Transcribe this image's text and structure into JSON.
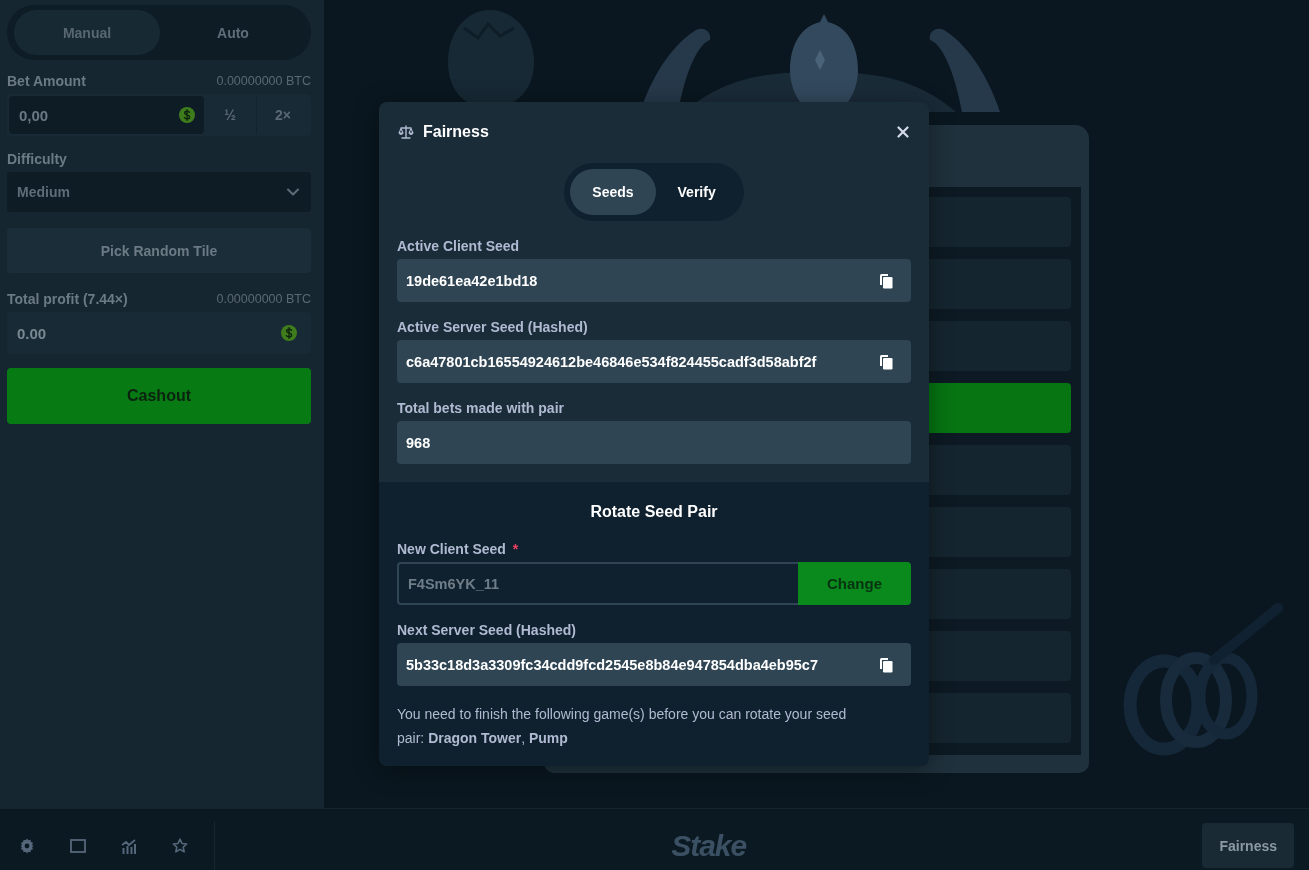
{
  "sidebar": {
    "mode_tabs": [
      {
        "label": "Manual",
        "selected": true
      },
      {
        "label": "Auto",
        "selected": false
      }
    ],
    "bet_amount": {
      "label": "Bet Amount",
      "reading": "0.00000000 BTC",
      "value": "0,00",
      "buttons": [
        "½",
        "2×"
      ]
    },
    "difficulty": {
      "label": "Difficulty",
      "value": "Medium"
    },
    "pick_button": "Pick Random Tile",
    "total_profit": {
      "label": "Total profit (7.44×)",
      "reading": "0.00000000 BTC",
      "value": "0.00"
    },
    "cashout_button": "Cashout"
  },
  "game": {
    "tower_rows": [
      {
        "active": false
      },
      {
        "active": false
      },
      {
        "active": false
      },
      {
        "active": true
      },
      {
        "active": false
      },
      {
        "active": false
      },
      {
        "active": false
      },
      {
        "active": false
      },
      {
        "active": false
      }
    ]
  },
  "modal": {
    "title": "Fairness",
    "tabs": [
      {
        "label": "Seeds",
        "selected": true
      },
      {
        "label": "Verify",
        "selected": false
      }
    ],
    "fields": [
      {
        "label": "Active Client Seed",
        "value": "19de61ea42e1bd18",
        "copyable": true
      },
      {
        "label": "Active Server Seed (Hashed)",
        "value": "c6a47801cb16554924612be46846e534f824455cadf3d58abf2f",
        "copyable": true
      },
      {
        "label": "Total bets made with pair",
        "value": "968",
        "copyable": false
      }
    ],
    "rotate": {
      "title": "Rotate Seed Pair",
      "new_client_seed": {
        "label": "New Client Seed",
        "required_mark": "*",
        "value": "F4Sm6YK_11",
        "button": "Change",
        "disabled": true
      },
      "next_server_seed": {
        "label": "Next Server Seed (Hashed)",
        "value": "5b33c18d3a3309fc34cdd9fcd2545e8b84e947854dba4eb95c7",
        "copyable": true
      },
      "note": "You need to finish the following game(s) before you can rotate your seed pair: **Dragon Tower**, **Pump**"
    }
  },
  "footer": {
    "logo": "Stake",
    "fairness_button": "Fairness"
  }
}
